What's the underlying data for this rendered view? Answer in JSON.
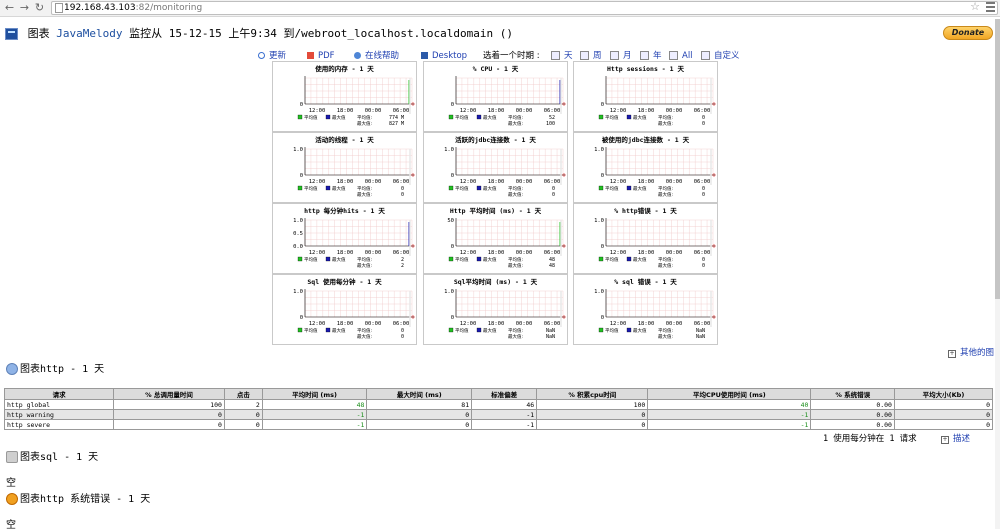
{
  "browser": {
    "url_host": "192.168.43.103",
    "url_path": ":82/monitoring"
  },
  "header": {
    "prefix": "图表",
    "app": "JavaMelody",
    "suffix": "监控从 15-12-15 上午9:34 到/webroot_localhost.localdomain ()",
    "donate": "Donate"
  },
  "toolbar": {
    "refresh": "更新",
    "pdf": "PDF",
    "help": "在线帮助",
    "desktop": "Desktop",
    "period_label": "选着一个时期 :",
    "day": "天",
    "week": "周",
    "month": "月",
    "year": "年",
    "all": "All",
    "custom": "自定义"
  },
  "chart_legend": {
    "avg": "平均值",
    "max": "最大值",
    "avg_value": "平均值:",
    "max_value": "最大值:"
  },
  "charts": [
    {
      "title": "使用的内存 - 1 天",
      "ymax": "",
      "ymid": "",
      "ymin": "0",
      "avg": "774 M",
      "max": "827 M",
      "spike": "green"
    },
    {
      "title": "% CPU - 1 天",
      "ymax": "",
      "ymid": "",
      "ymin": "0",
      "avg": "52",
      "max": "100",
      "spike": "blue"
    },
    {
      "title": "Http sessions - 1 天",
      "ymax": "",
      "ymid": "",
      "ymin": "0",
      "avg": "0",
      "max": "0",
      "spike": ""
    },
    {
      "title": "活动的线程 - 1 天",
      "ymax": "1.0",
      "ymid": "",
      "ymin": "0",
      "avg": "0",
      "max": "0",
      "spike": ""
    },
    {
      "title": "活跃的jdbc连接数 - 1 天",
      "ymax": "1.0",
      "ymid": "",
      "ymin": "0",
      "avg": "0",
      "max": "0",
      "spike": ""
    },
    {
      "title": "被使用的jdbc连接数 - 1 天",
      "ymax": "1.0",
      "ymid": "",
      "ymin": "0",
      "avg": "0",
      "max": "0",
      "spike": ""
    },
    {
      "title": "http 每分钟hits - 1 天",
      "ymax": "1.0",
      "ymid": "0.5",
      "ymin": "0.0",
      "avg": "2",
      "max": "2",
      "spike": "blue"
    },
    {
      "title": "Http 平均时间 (ms) - 1 天",
      "ymax": "50",
      "ymid": "",
      "ymin": "0",
      "avg": "48",
      "max": "48",
      "spike": "green"
    },
    {
      "title": "% http错误 - 1 天",
      "ymax": "1.0",
      "ymid": "",
      "ymin": "0",
      "avg": "0",
      "max": "0",
      "spike": ""
    },
    {
      "title": "Sql 使用每分钟 - 1 天",
      "ymax": "1.0",
      "ymid": "",
      "ymin": "0",
      "avg": "0",
      "max": "0",
      "spike": ""
    },
    {
      "title": "Sql平均时间 (ms) - 1 天",
      "ymax": "1.0",
      "ymid": "",
      "ymin": "0",
      "avg": "NaN",
      "max": "NaN",
      "spike": ""
    },
    {
      "title": "% sql 错误 - 1 天",
      "ymax": "1.0",
      "ymid": "",
      "ymin": "0",
      "avg": "NaN",
      "max": "NaN",
      "spike": ""
    }
  ],
  "x_ticks": [
    "12:00",
    "18:00",
    "00:00",
    "06:00"
  ],
  "other_charts": "其他的图",
  "http_section": {
    "title": "图表http - 1 天",
    "columns": [
      "请求",
      "% 总调用量时间",
      "点击",
      "平均时间 (ms)",
      "最大时间 (ms)",
      "标准偏差",
      "% 积累cpu时间",
      "平均CPU使用时间 (ms)",
      "% 系统错误",
      "平均大小(Kb)"
    ],
    "rows": [
      [
        "http global",
        "100",
        "2",
        "48",
        "81",
        "46",
        "100",
        "40",
        "0.00",
        "0"
      ],
      [
        "http warning",
        "0",
        "0",
        "-1",
        "0",
        "-1",
        "0",
        "-1",
        "0.00",
        "0"
      ],
      [
        "http severe",
        "0",
        "0",
        "-1",
        "0",
        "-1",
        "0",
        "-1",
        "0.00",
        "0"
      ]
    ],
    "footnote": "1 使用每分钟在 1 请求",
    "details": "描述"
  },
  "sql_section": {
    "title": "图表sql - 1 天",
    "empty": "空"
  },
  "error_section": {
    "title": "图表http 系统错误 - 1 天",
    "empty": "空"
  }
}
